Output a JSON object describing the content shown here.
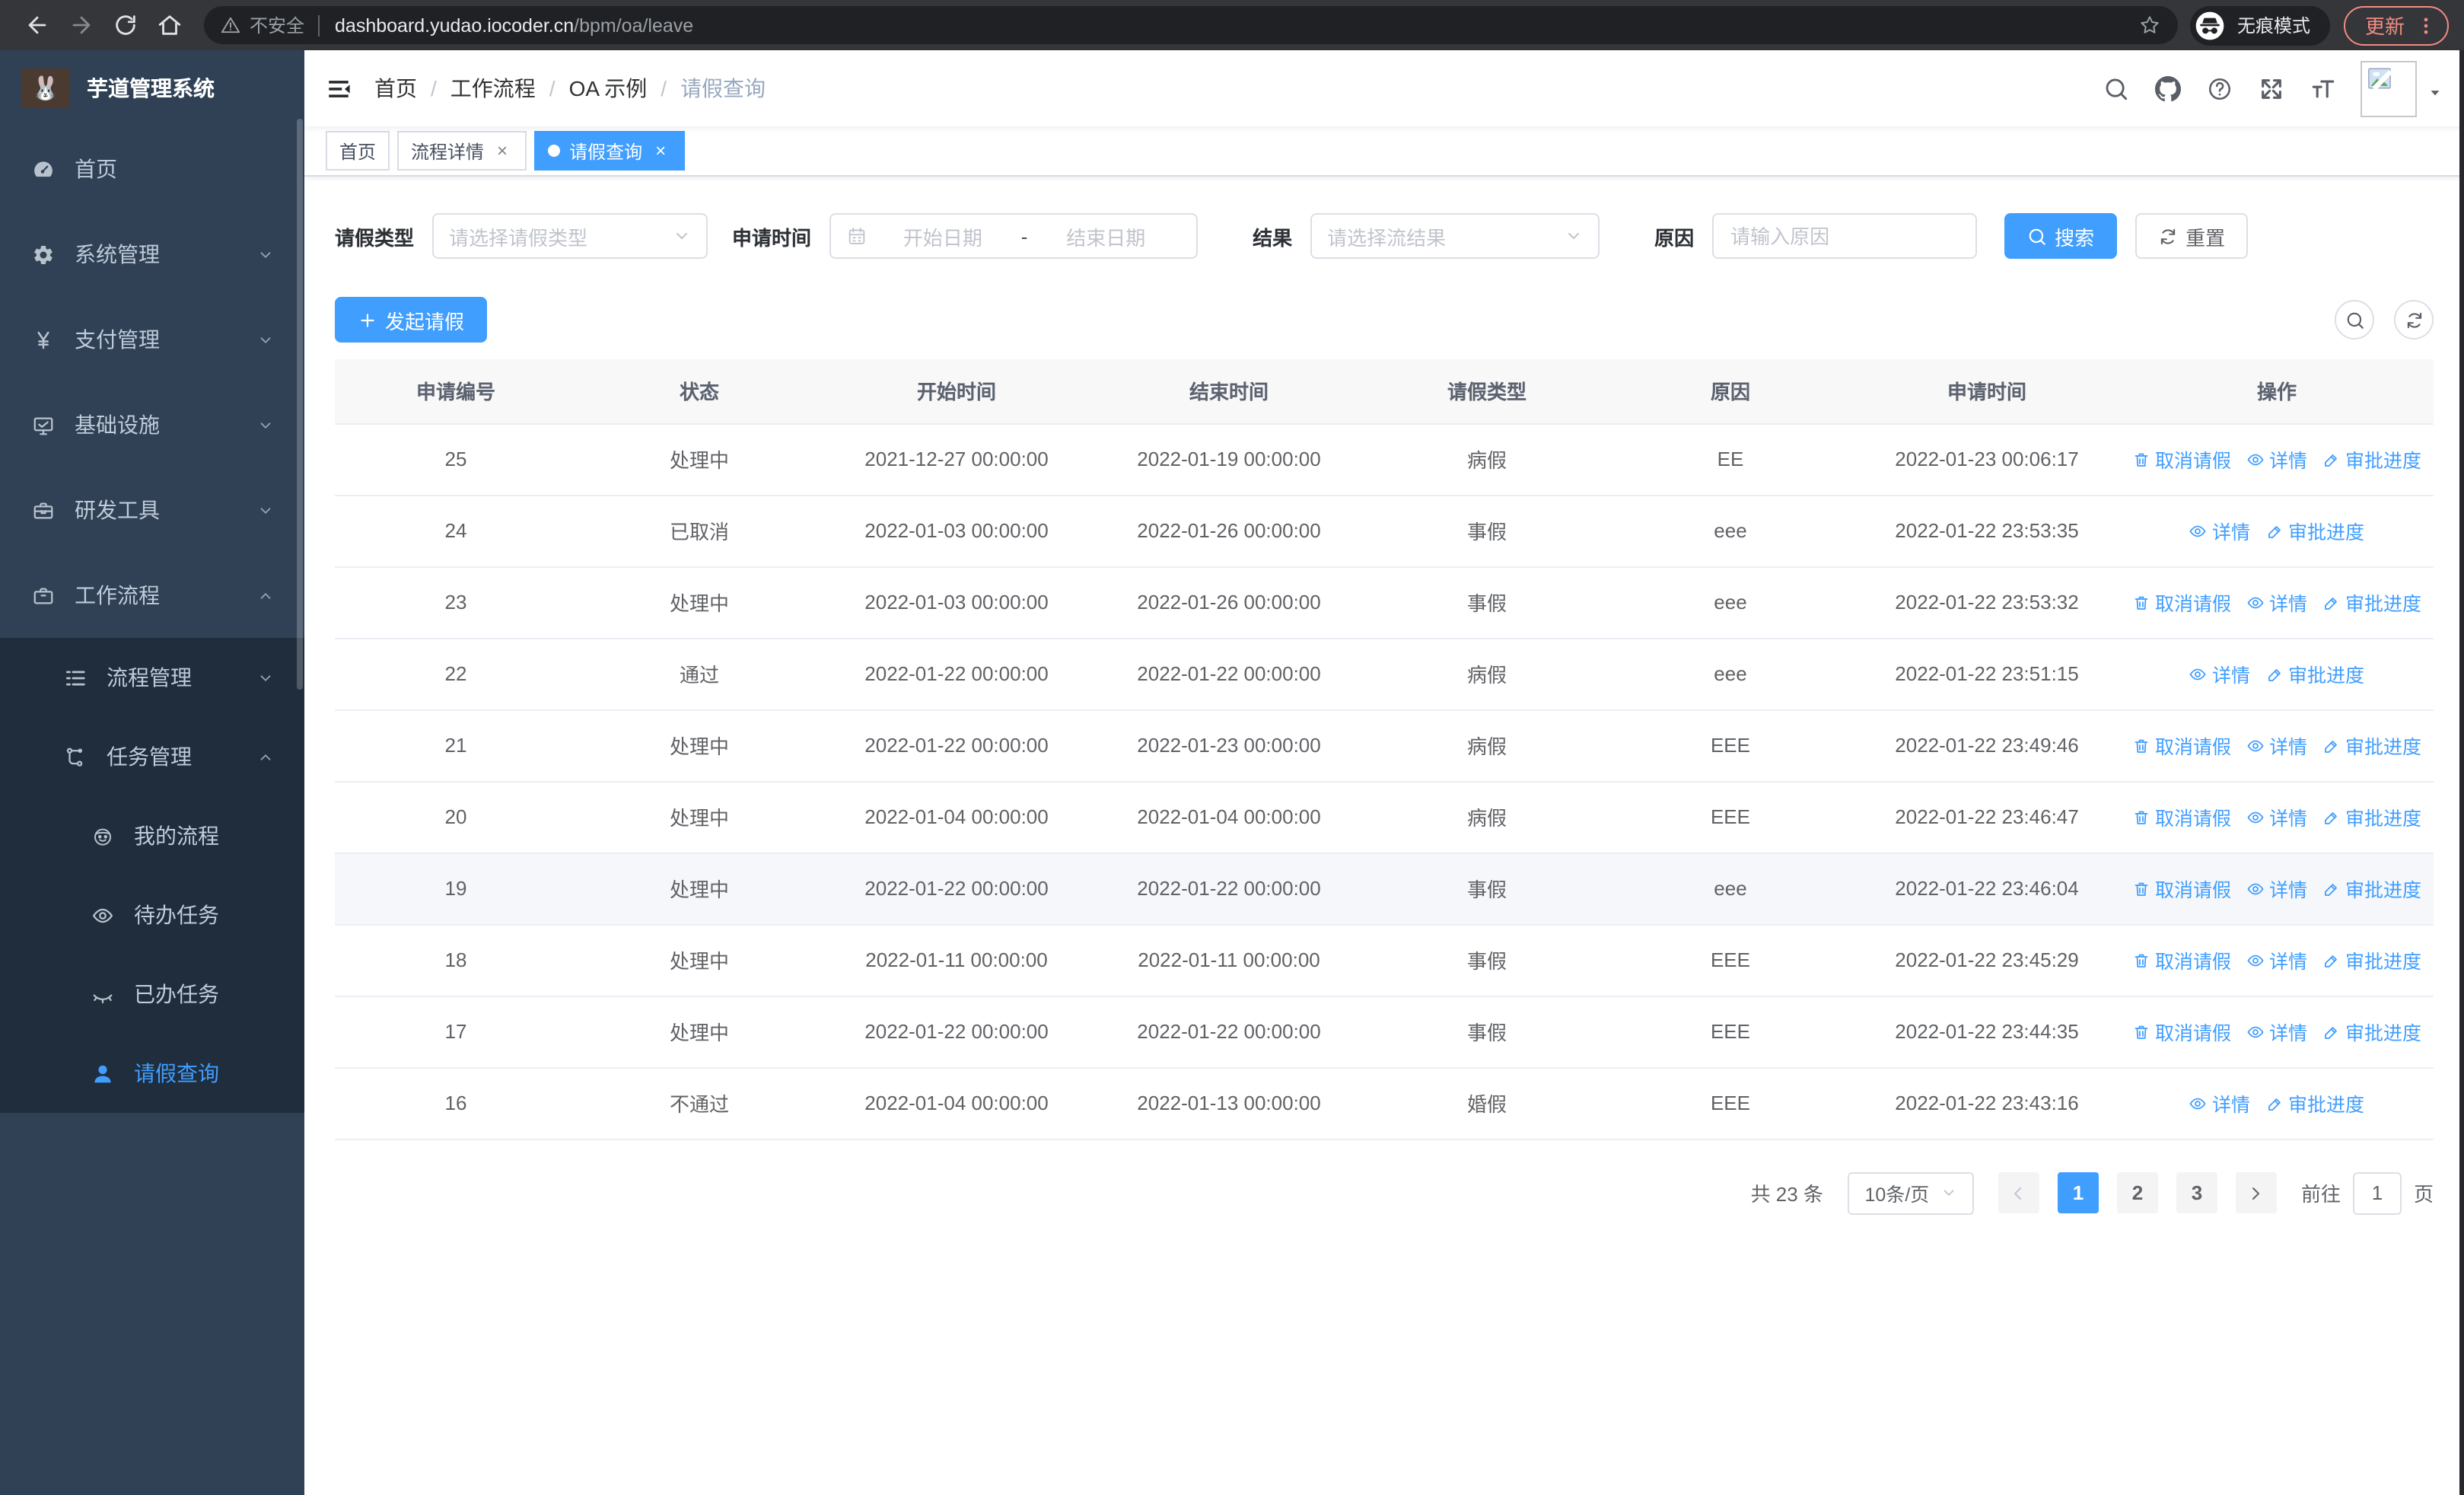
{
  "browser": {
    "security_label": "不安全",
    "url_host": "dashboard.yudao.iocoder.cn",
    "url_path": "/bpm/oa/leave",
    "incognito_label": "无痕模式",
    "update_label": "更新"
  },
  "sidebar": {
    "title": "芋道管理系统",
    "logo_emoji": "🐰",
    "menu": [
      {
        "icon": "dashboard",
        "label": "首页",
        "level": 1
      },
      {
        "icon": "gear",
        "label": "系统管理",
        "level": 1,
        "chevron": "down"
      },
      {
        "icon": "yen",
        "label": "支付管理",
        "level": 1,
        "chevron": "down"
      },
      {
        "icon": "monitor",
        "label": "基础设施",
        "level": 1,
        "chevron": "down"
      },
      {
        "icon": "toolbox",
        "label": "研发工具",
        "level": 1,
        "chevron": "down"
      },
      {
        "icon": "briefcase",
        "label": "工作流程",
        "level": 1,
        "chevron": "up"
      },
      {
        "icon": "list",
        "label": "流程管理",
        "level": 2,
        "chevron": "down"
      },
      {
        "icon": "flow",
        "label": "任务管理",
        "level": 2,
        "chevron": "up"
      },
      {
        "icon": "robot",
        "label": "我的流程",
        "level": 3
      },
      {
        "icon": "eye",
        "label": "待办任务",
        "level": 3
      },
      {
        "icon": "eye-closed",
        "label": "已办任务",
        "level": 3
      },
      {
        "icon": "user",
        "label": "请假查询",
        "level": 3,
        "active": true
      }
    ]
  },
  "header": {
    "breadcrumb": [
      "首页",
      "工作流程",
      "OA 示例",
      "请假查询"
    ]
  },
  "tabs": [
    {
      "label": "首页",
      "closable": false,
      "active": false
    },
    {
      "label": "流程详情",
      "closable": true,
      "active": false
    },
    {
      "label": "请假查询",
      "closable": true,
      "active": true
    }
  ],
  "filters": {
    "leave_type_label": "请假类型",
    "leave_type_placeholder": "请选择请假类型",
    "apply_time_label": "申请时间",
    "date_start_placeholder": "开始日期",
    "date_separator": "-",
    "date_end_placeholder": "结束日期",
    "result_label": "结果",
    "result_placeholder": "请选择流结果",
    "reason_label": "原因",
    "reason_placeholder": "请输入原因",
    "search_button": "搜索",
    "reset_button": "重置"
  },
  "toolbar": {
    "create_button": "发起请假"
  },
  "table": {
    "columns": [
      "申请编号",
      "状态",
      "开始时间",
      "结束时间",
      "请假类型",
      "原因",
      "申请时间",
      "操作"
    ],
    "actions": {
      "cancel": "取消请假",
      "detail": "详情",
      "progress": "审批进度"
    },
    "rows": [
      {
        "id": "25",
        "status": "处理中",
        "start": "2021-12-27 00:00:00",
        "end": "2022-01-19 00:00:00",
        "type": "病假",
        "reason": "EE",
        "apply_time": "2022-01-23 00:06:17",
        "cancelable": true,
        "hover": false
      },
      {
        "id": "24",
        "status": "已取消",
        "start": "2022-01-03 00:00:00",
        "end": "2022-01-26 00:00:00",
        "type": "事假",
        "reason": "eee",
        "apply_time": "2022-01-22 23:53:35",
        "cancelable": false,
        "hover": false
      },
      {
        "id": "23",
        "status": "处理中",
        "start": "2022-01-03 00:00:00",
        "end": "2022-01-26 00:00:00",
        "type": "事假",
        "reason": "eee",
        "apply_time": "2022-01-22 23:53:32",
        "cancelable": true,
        "hover": false
      },
      {
        "id": "22",
        "status": "通过",
        "start": "2022-01-22 00:00:00",
        "end": "2022-01-22 00:00:00",
        "type": "病假",
        "reason": "eee",
        "apply_time": "2022-01-22 23:51:15",
        "cancelable": false,
        "hover": false
      },
      {
        "id": "21",
        "status": "处理中",
        "start": "2022-01-22 00:00:00",
        "end": "2022-01-23 00:00:00",
        "type": "病假",
        "reason": "EEE",
        "apply_time": "2022-01-22 23:49:46",
        "cancelable": true,
        "hover": false
      },
      {
        "id": "20",
        "status": "处理中",
        "start": "2022-01-04 00:00:00",
        "end": "2022-01-04 00:00:00",
        "type": "病假",
        "reason": "EEE",
        "apply_time": "2022-01-22 23:46:47",
        "cancelable": true,
        "hover": false
      },
      {
        "id": "19",
        "status": "处理中",
        "start": "2022-01-22 00:00:00",
        "end": "2022-01-22 00:00:00",
        "type": "事假",
        "reason": "eee",
        "apply_time": "2022-01-22 23:46:04",
        "cancelable": true,
        "hover": true
      },
      {
        "id": "18",
        "status": "处理中",
        "start": "2022-01-11 00:00:00",
        "end": "2022-01-11 00:00:00",
        "type": "事假",
        "reason": "EEE",
        "apply_time": "2022-01-22 23:45:29",
        "cancelable": true,
        "hover": false
      },
      {
        "id": "17",
        "status": "处理中",
        "start": "2022-01-22 00:00:00",
        "end": "2022-01-22 00:00:00",
        "type": "事假",
        "reason": "EEE",
        "apply_time": "2022-01-22 23:44:35",
        "cancelable": true,
        "hover": false
      },
      {
        "id": "16",
        "status": "不通过",
        "start": "2022-01-04 00:00:00",
        "end": "2022-01-13 00:00:00",
        "type": "婚假",
        "reason": "EEE",
        "apply_time": "2022-01-22 23:43:16",
        "cancelable": false,
        "hover": false
      }
    ]
  },
  "pagination": {
    "total_text": "共 23 条",
    "page_size": "10条/页",
    "pages": [
      "1",
      "2",
      "3"
    ],
    "active_page": "1",
    "jump_prefix": "前往",
    "jump_value": "1",
    "jump_suffix": "页"
  },
  "colors": {
    "primary": "#409eff",
    "sidebar_bg": "#304156",
    "submenu_bg": "#1f2d3d",
    "update_accent": "#f28b82",
    "table_header_bg": "#f8f8f9"
  }
}
